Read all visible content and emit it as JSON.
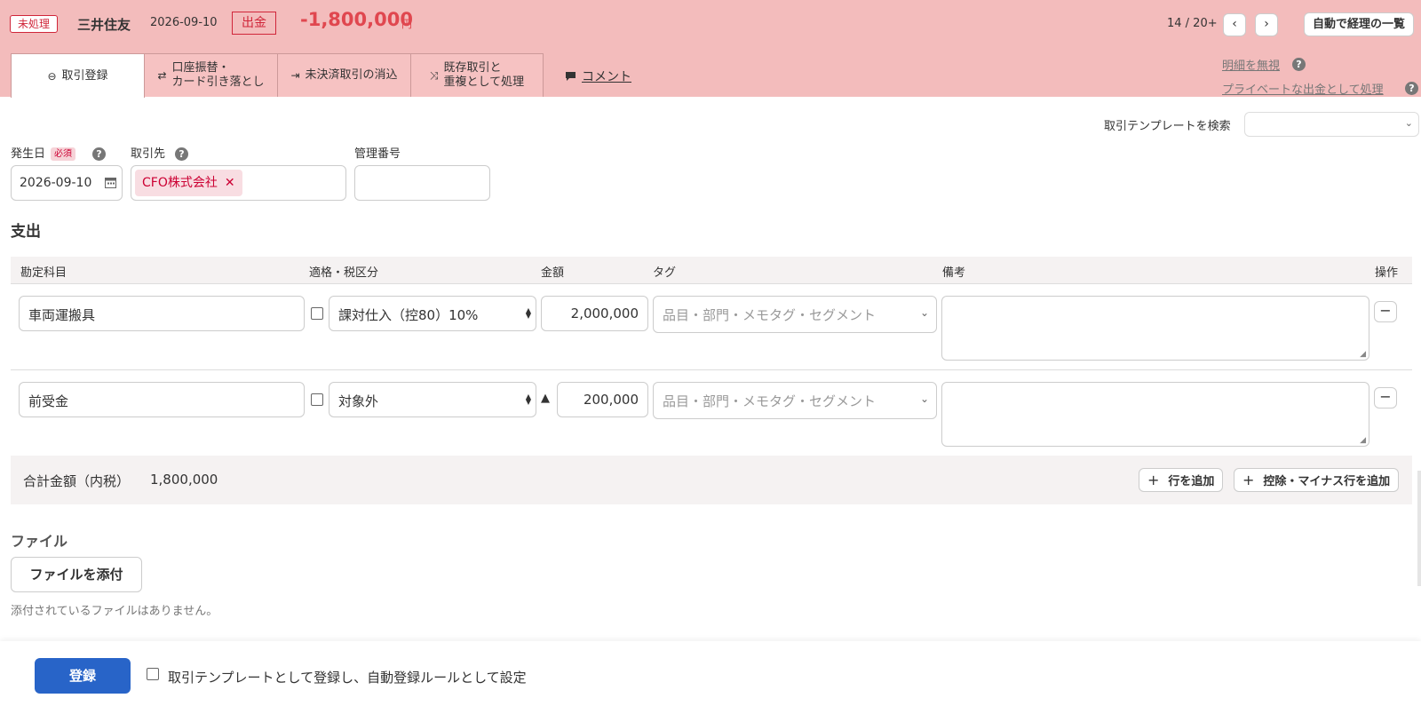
{
  "header": {
    "status": "未処理",
    "bank": "三井住友",
    "date": "2026-09-10",
    "type": "出金",
    "amount": "-1,800,000",
    "unit": "円",
    "pager": "14 / 20+",
    "prev": "‹",
    "next": "›",
    "list_button": "自動で経理の一覧"
  },
  "tabs": [
    {
      "icon": "⊖",
      "line1": "取引登録",
      "line2": ""
    },
    {
      "icon": "⇄",
      "line1": "口座振替・",
      "line2": "カード引き落とし"
    },
    {
      "icon": "⇥",
      "line1": "未決済取引の消込",
      "line2": ""
    },
    {
      "icon": "⤨",
      "line1": "既存取引と",
      "line2": "重複として処理"
    }
  ],
  "comment": "コメント",
  "side_links": {
    "ignore": "明細を無視",
    "private": "プライベートな出金として処理",
    "help": "?"
  },
  "template_search": {
    "label": "取引テンプレートを検索",
    "value": ""
  },
  "fields": {
    "date_label": "発生日",
    "required": "必須",
    "date_value": "2026-09-10",
    "partner_label": "取引先",
    "partner_value": "CFO株式会社",
    "mgmt_label": "管理番号",
    "mgmt_value": ""
  },
  "section_title": "支出",
  "table": {
    "headers": [
      "勘定科目",
      "適格・税区分",
      "金額",
      "タグ",
      "備考",
      "操作"
    ],
    "rows": [
      {
        "account": "車両運搬具",
        "tax": "課対仕入（控80）10%",
        "amount": "2,000,000",
        "minus_mark": "",
        "tag_placeholder": "品目・部門・メモタグ・セグメント",
        "note": ""
      },
      {
        "account": "前受金",
        "tax": "対象外",
        "amount": "200,000",
        "minus_mark": "▲",
        "tag_placeholder": "品目・部門・メモタグ・セグメント",
        "note": ""
      }
    ]
  },
  "total": {
    "label": "合計金額（内税）",
    "value": "1,800,000",
    "add_row": "行を追加",
    "add_minus_row": "控除・マイナス行を追加"
  },
  "files": {
    "title": "ファイル",
    "attach": "ファイルを添付",
    "empty": "添付されているファイルはありません。"
  },
  "footer": {
    "submit": "登録",
    "template_check_label": "取引テンプレートとして登録し、自動登録ルールとして設定"
  },
  "colors": {
    "header_bg": "#f3bcbc",
    "accent_red": "#d0263a",
    "amount_red": "#e0474f",
    "primary_blue": "#2864c8"
  }
}
